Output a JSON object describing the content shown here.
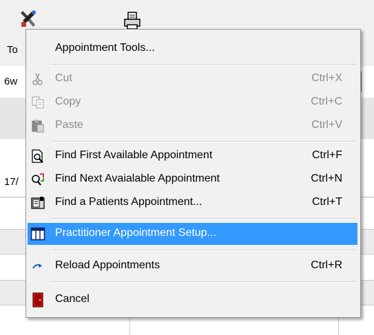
{
  "toolbar": {
    "tools_label_fragment": "To",
    "tools_icon": "tools-icon",
    "print_icon": "print-icon"
  },
  "background": {
    "row_fragment_1": "6w",
    "row_fragment_2": "17/"
  },
  "menu": {
    "items": [
      {
        "label": "Appointment Tools...",
        "shortcut": "",
        "icon": "none",
        "enabled": true
      },
      {
        "label": "Cut",
        "shortcut": "Ctrl+X",
        "icon": "scissors-icon",
        "enabled": false
      },
      {
        "label": "Copy",
        "shortcut": "Ctrl+C",
        "icon": "copy-icon",
        "enabled": false
      },
      {
        "label": "Paste",
        "shortcut": "Ctrl+V",
        "icon": "paste-icon",
        "enabled": false
      },
      {
        "label": "Find First Available Appointment",
        "shortcut": "Ctrl+F",
        "icon": "find-document-icon",
        "enabled": true
      },
      {
        "label": "Find Next Avaialable Appointment",
        "shortcut": "Ctrl+N",
        "icon": "find-next-icon",
        "enabled": true
      },
      {
        "label": "Find a Patients Appointment...",
        "shortcut": "Ctrl+T",
        "icon": "patient-file-icon",
        "enabled": true
      },
      {
        "label": "Practitioner Appointment Setup...",
        "shortcut": "",
        "icon": "window-columns-icon",
        "enabled": true,
        "highlighted": true
      },
      {
        "label": "Reload Appointments",
        "shortcut": "Ctrl+R",
        "icon": "reload-arrow-icon",
        "enabled": true
      },
      {
        "label": "Cancel",
        "shortcut": "",
        "icon": "exit-door-icon",
        "enabled": true
      }
    ],
    "highlight_color": "#3399ff",
    "disabled_color": "#8c8c8c"
  }
}
